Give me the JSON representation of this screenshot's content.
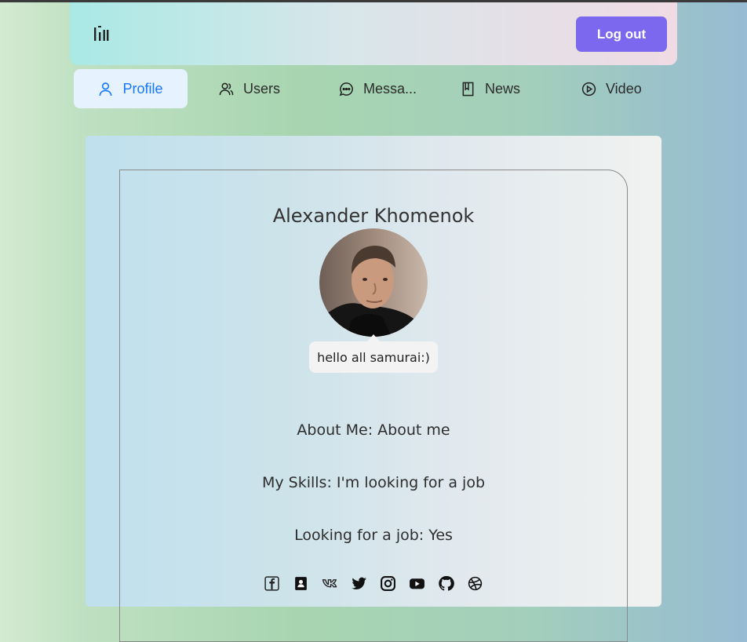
{
  "header": {
    "logout_label": "Log out",
    "logo_icon": "bars-logo-icon"
  },
  "nav": {
    "items": [
      {
        "label": "Profile",
        "icon": "user-icon",
        "active": true
      },
      {
        "label": "Users",
        "icon": "users-icon",
        "active": false
      },
      {
        "label": "Messa...",
        "icon": "message-icon",
        "active": false
      },
      {
        "label": "News",
        "icon": "book-icon",
        "active": false
      },
      {
        "label": "Video",
        "icon": "play-circle-icon",
        "active": false
      }
    ]
  },
  "profile": {
    "name": "Alexander Khomenok",
    "status": "hello all samurai:)",
    "about": "About Me: About me",
    "skills": "My Skills: I'm looking for a job",
    "looking": "Looking for a job: Yes",
    "socials": [
      "facebook-icon",
      "contact-book-icon",
      "vk-icon",
      "twitter-icon",
      "instagram-icon",
      "youtube-icon",
      "github-icon",
      "dribbble-icon"
    ]
  },
  "colors": {
    "accent": "#7b68ee",
    "active_nav": "#1677ff",
    "active_nav_bg": "#e6f3ff"
  }
}
